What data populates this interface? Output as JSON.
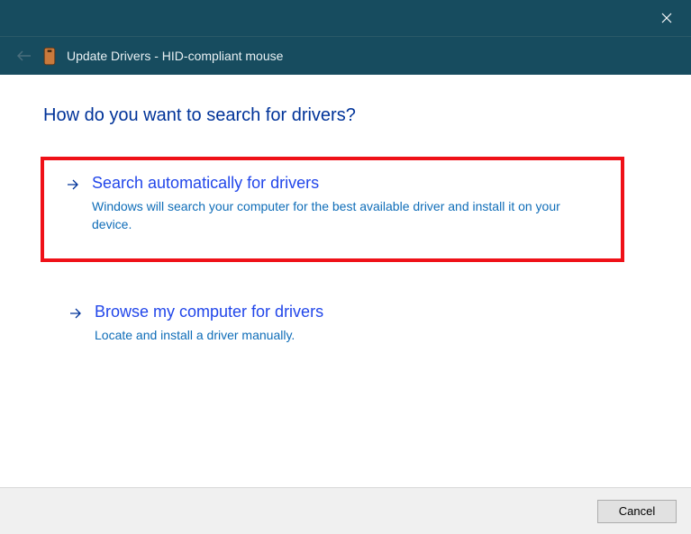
{
  "titlebar": {
    "nav_title": "Update Drivers - HID-compliant mouse"
  },
  "heading": "How do you want to search for drivers?",
  "options": [
    {
      "title": "Search automatically for drivers",
      "desc": "Windows will search your computer for the best available driver and install it on your device.",
      "highlighted": true
    },
    {
      "title": "Browse my computer for drivers",
      "desc": "Locate and install a driver manually.",
      "highlighted": false
    }
  ],
  "footer": {
    "cancel_label": "Cancel"
  },
  "colors": {
    "titlebar_bg": "#174c5f",
    "heading_color": "#003399",
    "link_title": "#2146ea",
    "link_desc": "#0f6db8",
    "highlight_border": "#ef1118"
  }
}
